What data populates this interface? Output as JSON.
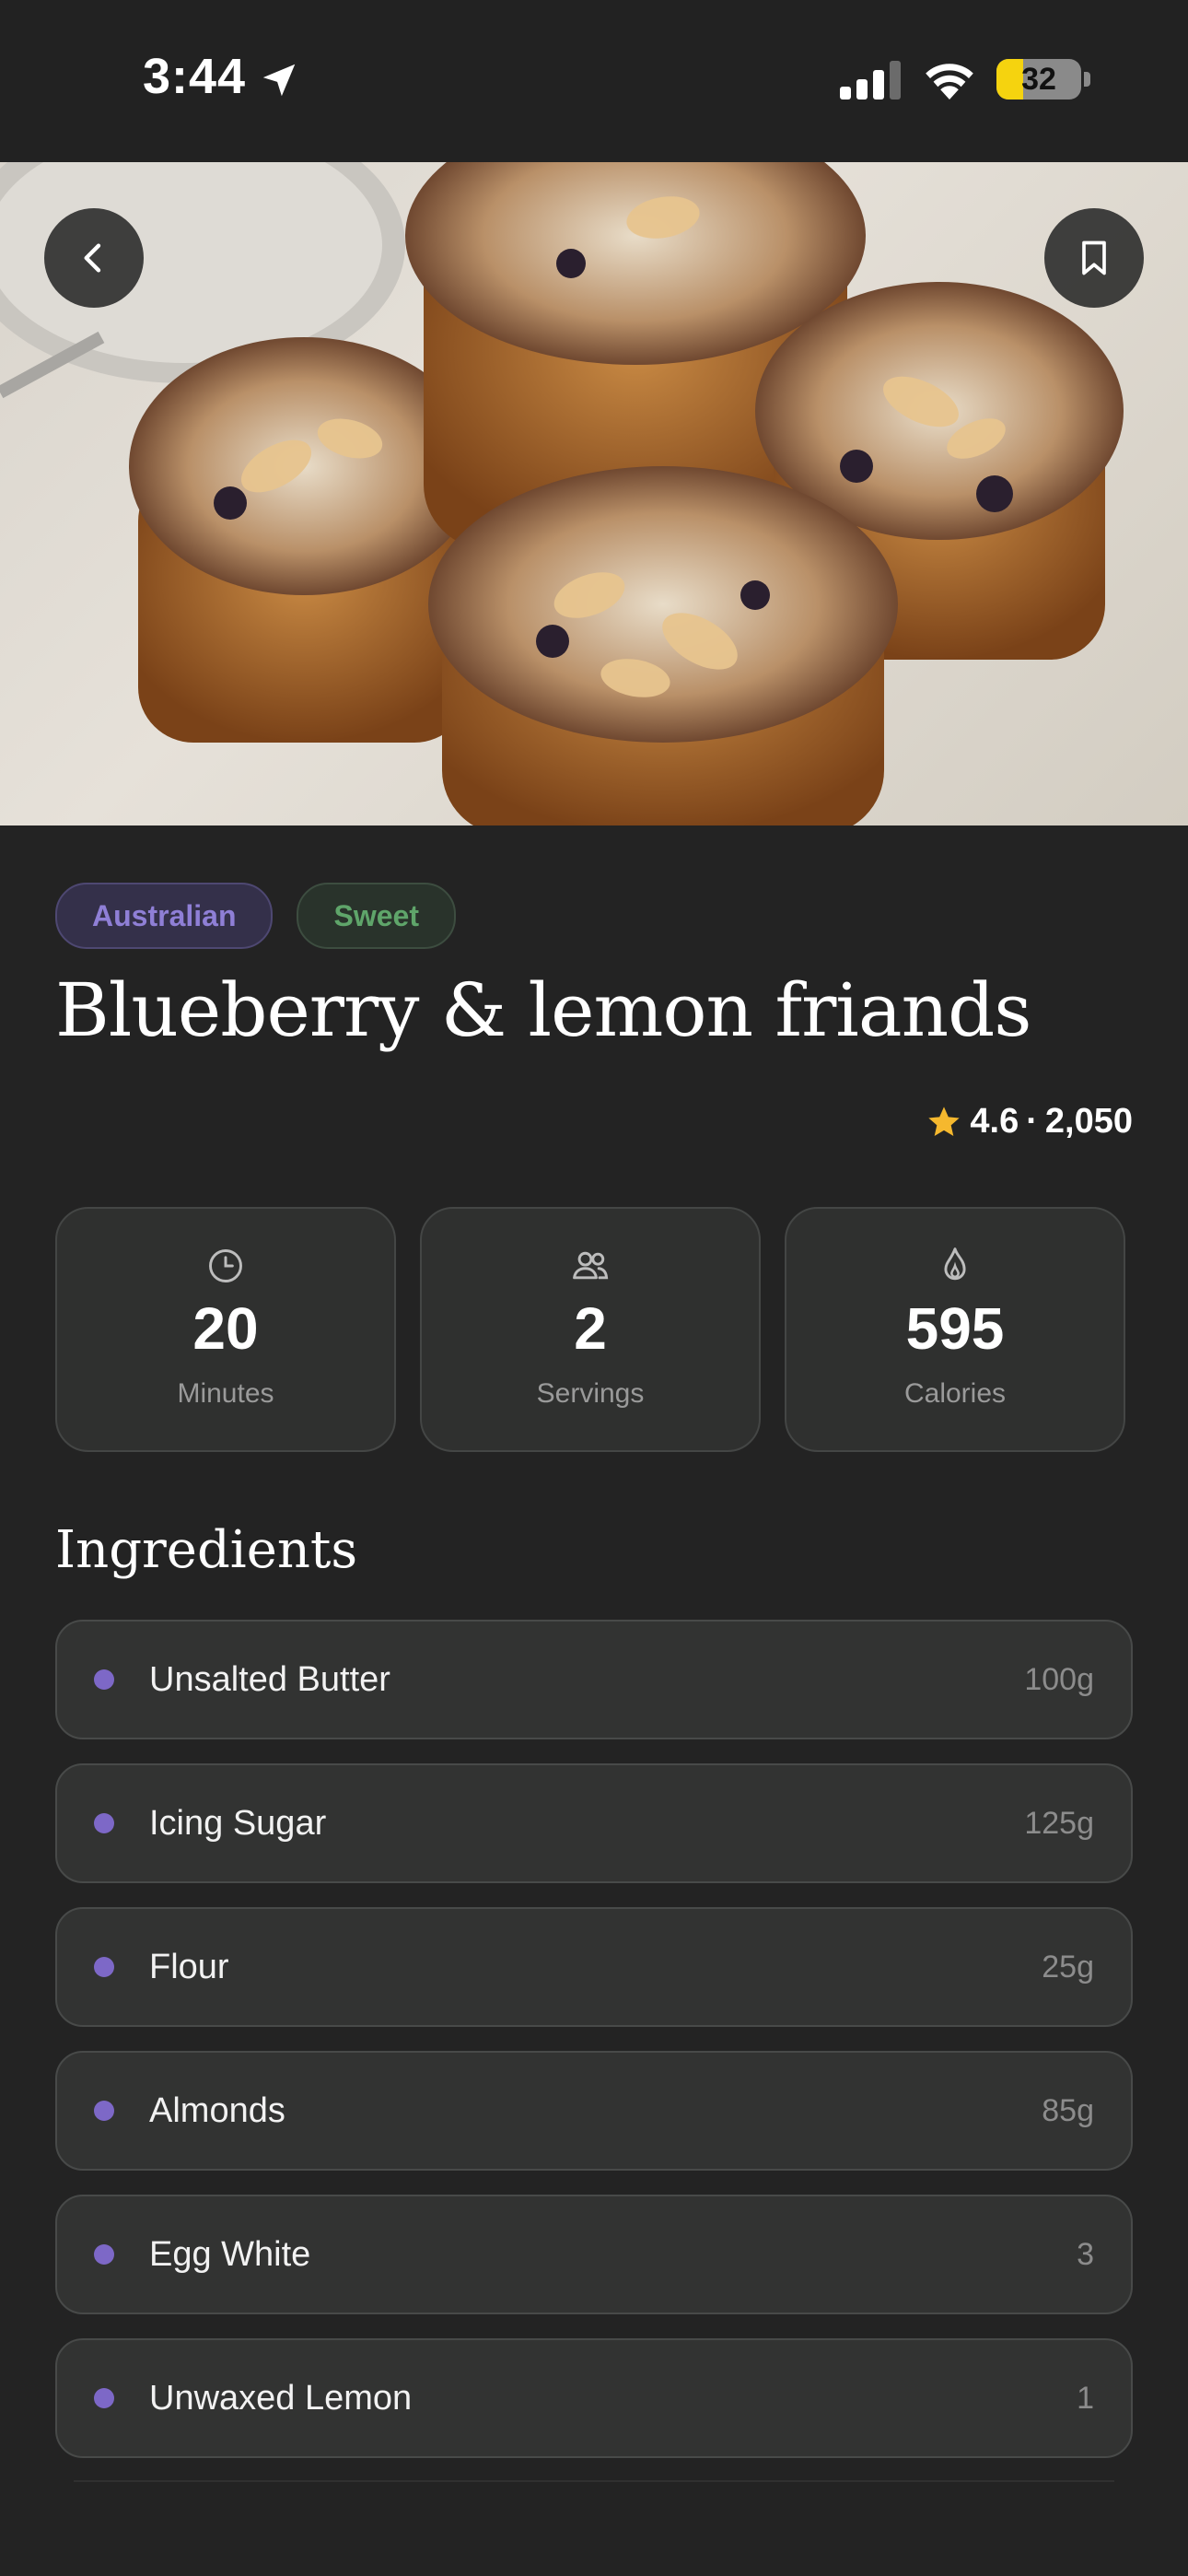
{
  "status_bar": {
    "time": "3:44",
    "battery_level": "32",
    "battery_fraction": 0.32,
    "icons": [
      "location-arrow-icon",
      "cellular-signal-icon",
      "wifi-icon",
      "battery-icon"
    ]
  },
  "hero": {
    "image_alt": "",
    "back_icon": "chevron-left-icon",
    "bookmark_icon": "bookmark-icon"
  },
  "recipe": {
    "tags": [
      {
        "label": "Australian",
        "color": "#8f7fd6"
      },
      {
        "label": "Sweet",
        "color": "#5fa56a"
      }
    ],
    "title": "Blueberry & lemon friands",
    "rating": "4.6",
    "rating_separator": "·",
    "review_count": "2,050",
    "star_color": "#f5b82e"
  },
  "stats": [
    {
      "icon": "clock-icon",
      "value": "20",
      "label": "Minutes"
    },
    {
      "icon": "people-icon",
      "value": "2",
      "label": "Servings"
    },
    {
      "icon": "flame-icon",
      "value": "595",
      "label": "Calories"
    }
  ],
  "ingredients": {
    "title": "Ingredients",
    "bullet_color": "#7d68c7",
    "items": [
      {
        "name": "Unsalted Butter",
        "qty": "100g"
      },
      {
        "name": "Icing Sugar",
        "qty": "125g"
      },
      {
        "name": "Flour",
        "qty": "25g"
      },
      {
        "name": "Almonds",
        "qty": "85g"
      },
      {
        "name": "Egg White",
        "qty": "3"
      },
      {
        "name": "Unwaxed Lemon",
        "qty": "1"
      }
    ]
  }
}
